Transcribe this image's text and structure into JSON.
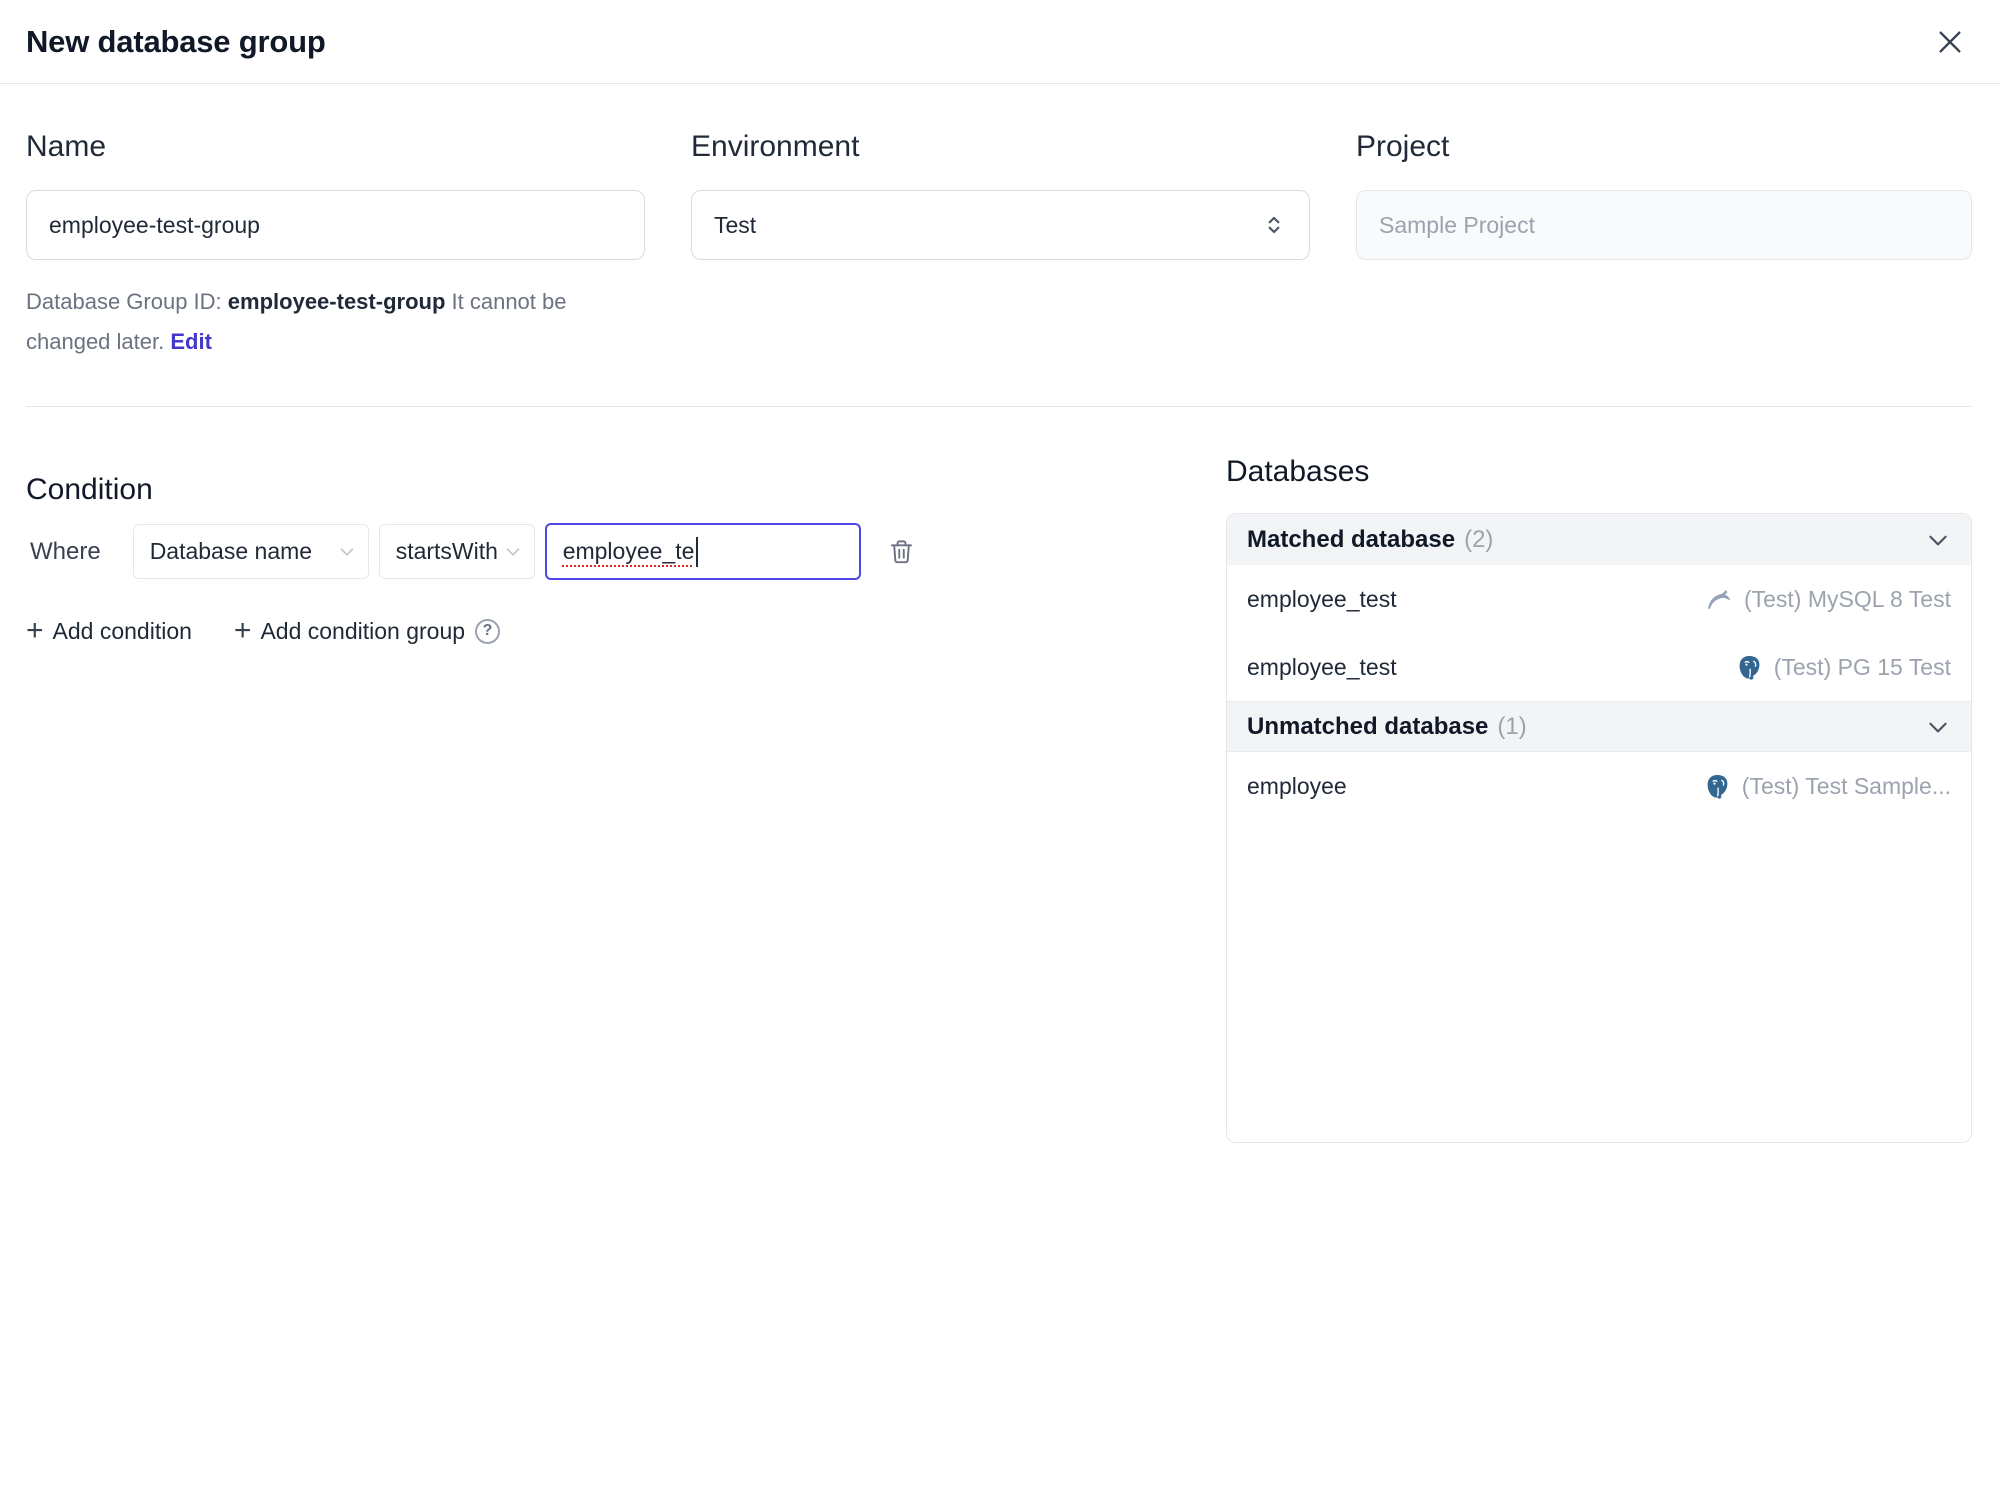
{
  "dialog": {
    "title": "New database group"
  },
  "form": {
    "name": {
      "label": "Name",
      "value": "employee-test-group"
    },
    "environment": {
      "label": "Environment",
      "value": "Test"
    },
    "project": {
      "label": "Project",
      "value": "Sample Project"
    },
    "group_id": {
      "prefix": "Database Group ID:",
      "id": "employee-test-group",
      "suffix": "It cannot be changed later.",
      "edit_label": "Edit"
    }
  },
  "condition": {
    "heading": "Condition",
    "where_label": "Where",
    "field_selected": "Database name",
    "operator_selected": "startsWith",
    "value": "employee_te",
    "add_condition_label": "Add condition",
    "add_condition_group_label": "Add condition group"
  },
  "databases": {
    "heading": "Databases",
    "groups": [
      {
        "title": "Matched database",
        "count": "(2)",
        "rows": [
          {
            "name": "employee_test",
            "engine": "mysql",
            "instance": "(Test) MySQL 8 Test"
          },
          {
            "name": "employee_test",
            "engine": "postgresql",
            "instance": "(Test) PG 15 Test"
          }
        ]
      },
      {
        "title": "Unmatched database",
        "count": "(1)",
        "rows": [
          {
            "name": "employee",
            "engine": "postgresql",
            "instance": "(Test) Test Sample..."
          }
        ]
      }
    ]
  },
  "icons": {
    "close": "✕",
    "plus": "+",
    "help": "?"
  },
  "colors": {
    "accent": "#4f46e5",
    "edit_link": "#4338ca",
    "text": "#1f2937",
    "muted": "#9ca3af",
    "border": "#e5e7eb",
    "group_header_bg": "#f3f4f6",
    "postgres_blue": "#336791",
    "mysql_gray": "#94a3b8",
    "spellcheck_red": "#dc2626"
  }
}
